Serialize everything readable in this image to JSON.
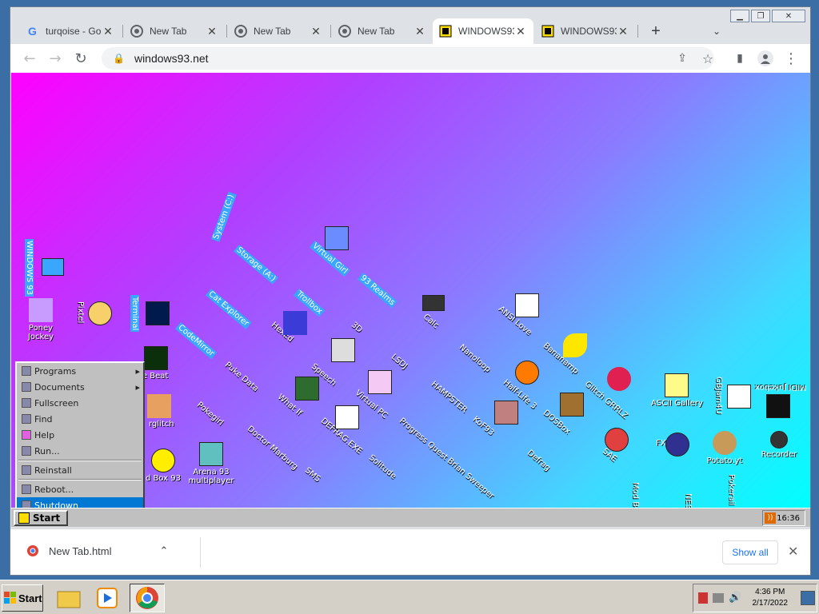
{
  "browser": {
    "tabs": [
      {
        "title": "turqoise - Go",
        "icon": "google-icon",
        "active": false
      },
      {
        "title": "New Tab",
        "icon": "chrome-icon",
        "active": false
      },
      {
        "title": "New Tab",
        "icon": "chrome-icon",
        "active": false
      },
      {
        "title": "New Tab",
        "icon": "chrome-icon",
        "active": false
      },
      {
        "title": "WINDOWS93",
        "icon": "windows93-icon",
        "active": true
      },
      {
        "title": "WINDOWS93",
        "icon": "windows93-icon",
        "active": false
      }
    ],
    "new_tab": "+",
    "url": "windows93.net",
    "download": {
      "filename": "New Tab.html",
      "show_all": "Show all"
    }
  },
  "win93": {
    "icons": {
      "windows93": "WINDOWS 93",
      "poney": "Poney Jockey",
      "pixtel": "Pixtel",
      "terminal": "Terminal",
      "system": "System (C:)",
      "storage": "Storage (A:)",
      "virtual_girl": "Virtual Girl",
      "realms": "93 Realms",
      "cat_explorer": "Cat Explorer",
      "trollbox": "Trollbox",
      "codemirror": "CodeMirror",
      "hexed": "HexEd",
      "threed": "3D",
      "calc": "Calc",
      "ansi": "ANSI Love",
      "puke": "Puke Data",
      "speech": "Speech",
      "lsdj": "LSDJ",
      "nanoloop": "Nanoloop",
      "bananamp": "Bananamp",
      "beat": "te Beat",
      "whatif": "What If",
      "virtualpc": "Virtual PC",
      "hampster": "HAMPSTER",
      "halflife": "Half-Life 3",
      "glitch": "Glitch GRRLZ",
      "ascii": "ASCII Gallery",
      "gbjam": "GBJam4U",
      "midi": "MIDI Jukebox",
      "pokegirl": "Pokegirl",
      "doctor": "Doctor Marburg",
      "defrag": "DEFRAG.EXE",
      "progress": "Progress Quest",
      "kof": "KoF93",
      "dosbox": "DOSBox",
      "fx": "FX",
      "potato": "Potato.yt",
      "recorder": "Recorder",
      "corglitch": "rglitch",
      "arena": "Arena 93 multiplayer",
      "box": "d Box 93",
      "solitude": "Solitude",
      "brian": "Brian Sweeper",
      "defrag2": "Defrag",
      "sae": "SAE",
      "sms": "SMS",
      "modbeep": "Mod Beep",
      "pokerail": "Pokerail",
      "nes": "NES"
    },
    "menu": {
      "items": [
        "Programs",
        "Documents",
        "Fullscreen",
        "Find",
        "Help",
        "Run...",
        "Reinstall",
        "Reboot...",
        "Shutdown"
      ],
      "selected": "Shutdown"
    },
    "start": "Start",
    "clock": "16:36"
  },
  "taskbar": {
    "start": "Start",
    "time": "4:36 PM",
    "date": "2/17/2022"
  }
}
